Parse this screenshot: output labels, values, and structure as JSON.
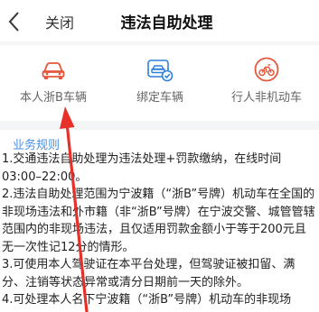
{
  "header": {
    "close_label": "关闭",
    "title": "违法自助处理"
  },
  "tabs": [
    {
      "label": "本人浙B车辆",
      "icon": "car-icon",
      "active": true
    },
    {
      "label": "绑定车辆",
      "icon": "bind-car-icon",
      "active": false
    },
    {
      "label": "行人非机动车",
      "icon": "pedestrian-bike-icon",
      "active": false
    }
  ],
  "rules": {
    "title": "业务规则",
    "items": [
      "1.交通违法自助处理为违法处理+罚款缴纳，在线时间03:00–22:00。",
      "2.违法自助处理范围为宁波籍（“浙B”号牌）机动车在全国的非现场违法和外市籍（非“浙B”号牌）在宁波交警、城管管辖范围内的非现场违法，且仅适用罚款金额小于等于200元且无一次性记12分的情形。",
      "3.可使用本人驾驶证在本平台处理，但驾驶证被扣留、满分、注销等状态异常或清分日期前一天的除外。",
      "4.可处理本人名下宁波籍（“浙B”号牌）机动车的非现场"
    ]
  },
  "colors": {
    "accent": "#e4573b",
    "link_blue": "#4a90e2",
    "annotation_red": "#e8302a"
  }
}
